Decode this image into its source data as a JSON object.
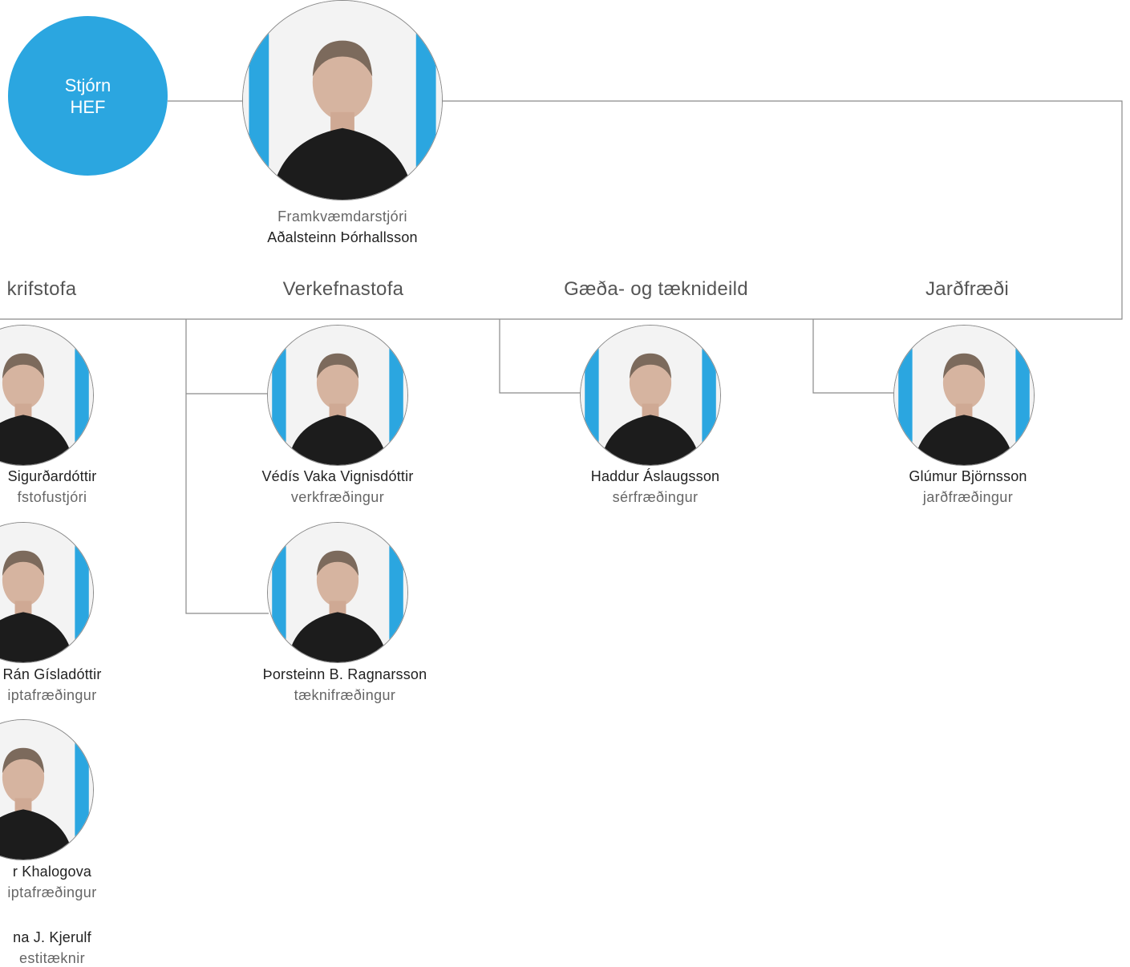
{
  "board": {
    "line1": "Stjórn",
    "line2": "HEF"
  },
  "director": {
    "role": "Framkvæmdarstjóri",
    "name": "Aðalsteinn Þórhallsson",
    "photo": "portrait-photo"
  },
  "departments": [
    {
      "label": "krifstofa",
      "members": [
        {
          "name": "Sigurðardóttir",
          "role": "fstofustjóri",
          "photo": "portrait-photo"
        },
        {
          "name": "Rán Gísladóttir",
          "role": "iptafræðingur",
          "photo": "portrait-photo"
        },
        {
          "name": "r Khalogova",
          "role": "iptafræðingur",
          "photo": "portrait-photo"
        },
        {
          "name": "na J. Kjerulf",
          "role": "estitæknir"
        }
      ]
    },
    {
      "label": "Verkefnastofa",
      "members": [
        {
          "name": "Védís Vaka Vignisdóttir",
          "role": "verkfræðingur",
          "photo": "portrait-photo"
        },
        {
          "name": "Þorsteinn B. Ragnarsson",
          "role": "tæknifræðingur",
          "photo": "portrait-photo"
        }
      ]
    },
    {
      "label": "Gæða- og tæknideild",
      "members": [
        {
          "name": "Haddur Áslaugsson",
          "role": "sérfræðingur",
          "photo": "portrait-photo"
        }
      ]
    },
    {
      "label": "Jarðfræði",
      "members": [
        {
          "name": "Glúmur Björnsson",
          "role": "jarðfræðingur",
          "photo": "portrait-photo"
        }
      ]
    }
  ],
  "colors": {
    "accent": "#2ba6e0",
    "line": "#8a8a8a",
    "jacket": "#1c1c1c"
  }
}
